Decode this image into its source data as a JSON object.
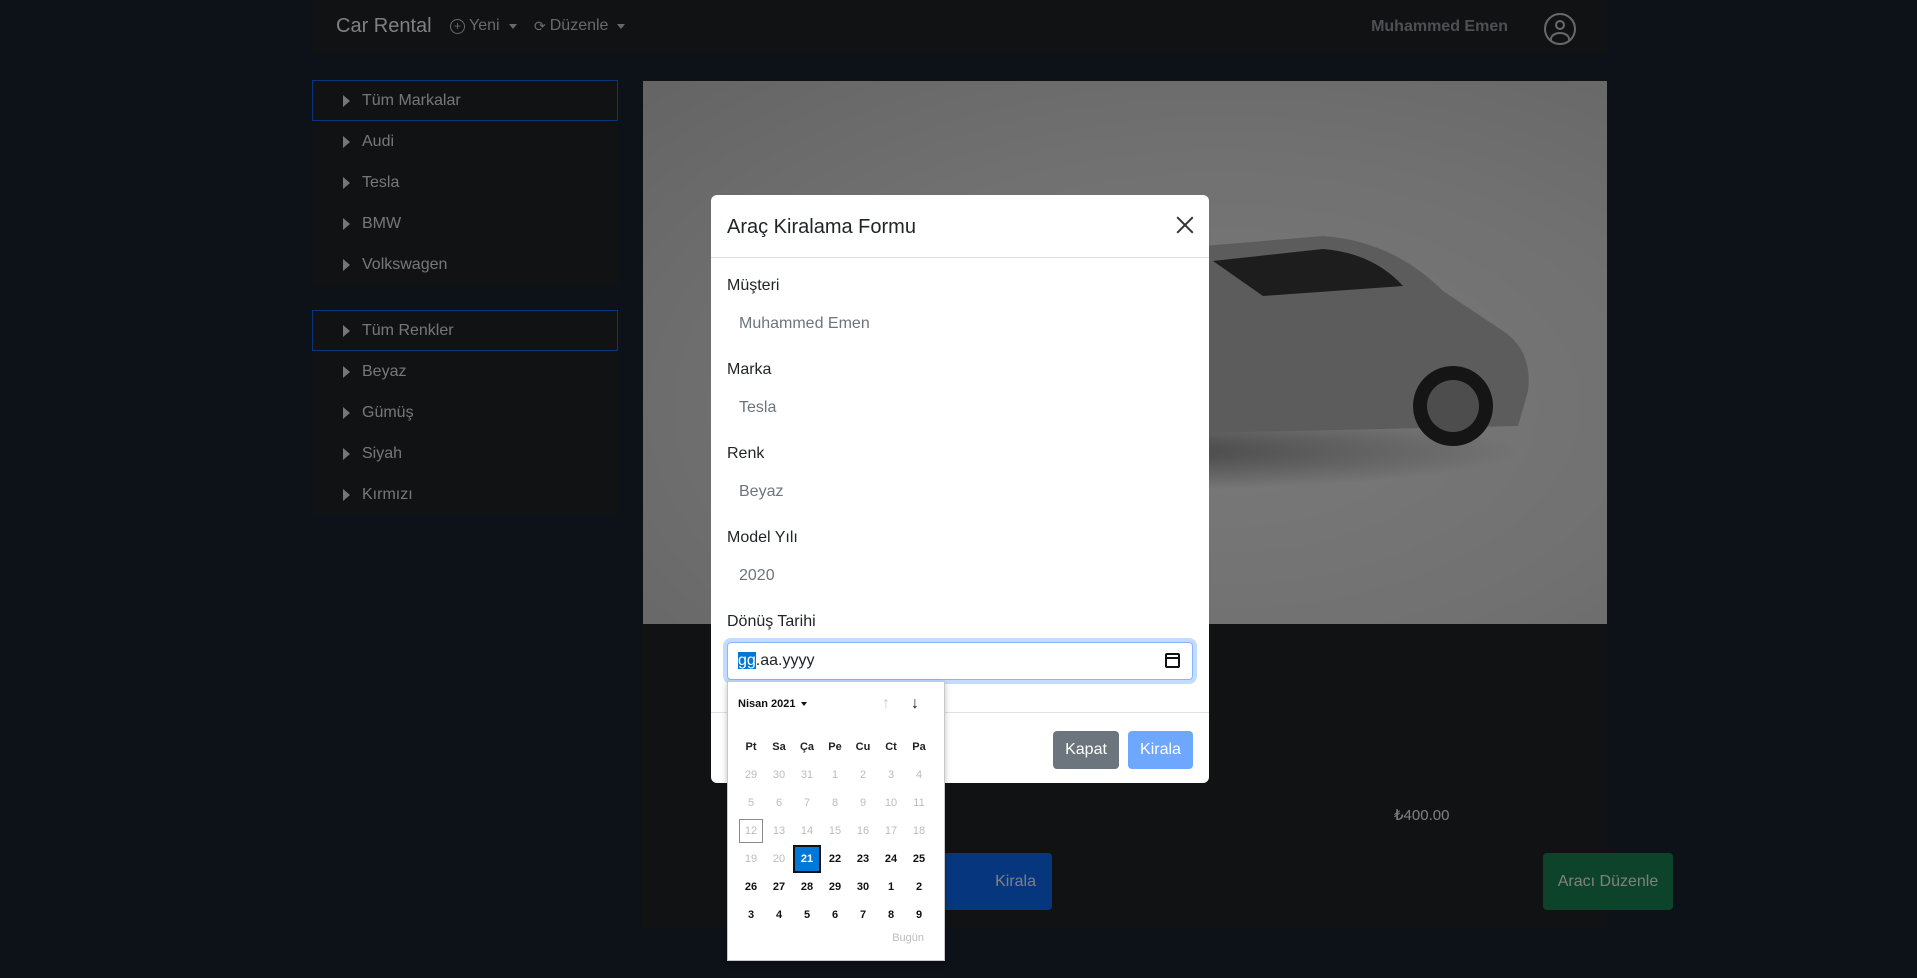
{
  "navbar": {
    "brand": "Car Rental",
    "menu_new": "Yeni",
    "menu_edit": "Düzenle",
    "user_name": "Muhammed Emen"
  },
  "brands": {
    "all": "Tüm Markalar",
    "items": [
      "Audi",
      "Tesla",
      "BMW",
      "Volkswagen"
    ]
  },
  "colors": {
    "all": "Tüm Renkler",
    "items": [
      "Beyaz",
      "Gümüş",
      "Siyah",
      "Kırmızı"
    ]
  },
  "card": {
    "price": "₺400.00",
    "rent_button": "Kirala",
    "edit_button": "Aracı Düzenle"
  },
  "modal": {
    "title": "Araç Kiralama Formu",
    "customer_label": "Müşteri",
    "customer_value": "Muhammed Emen",
    "brand_label": "Marka",
    "brand_value": "Tesla",
    "color_label": "Renk",
    "color_value": "Beyaz",
    "year_label": "Model Yılı",
    "year_value": "2020",
    "return_date_label": "Dönüş Tarihi",
    "date_placeholder_day": "gg",
    "date_placeholder_rest": ".aa.yyyy",
    "close_button": "Kapat",
    "rent_button": "Kirala"
  },
  "calendar": {
    "month": "Nisan 2021",
    "weekdays": [
      "Pt",
      "Sa",
      "Ça",
      "Pe",
      "Cu",
      "Ct",
      "Pa"
    ],
    "weeks": [
      [
        "29",
        "30",
        "31",
        "1",
        "2",
        "3",
        "4"
      ],
      [
        "5",
        "6",
        "7",
        "8",
        "9",
        "10",
        "11"
      ],
      [
        "12",
        "13",
        "14",
        "15",
        "16",
        "17",
        "18"
      ],
      [
        "19",
        "20",
        "21",
        "22",
        "23",
        "24",
        "25"
      ],
      [
        "26",
        "27",
        "28",
        "29",
        "30",
        "1",
        "2"
      ],
      [
        "3",
        "4",
        "5",
        "6",
        "7",
        "8",
        "9"
      ]
    ],
    "today": "12",
    "selected": "21",
    "today_link": "Bugün"
  },
  "theme": {
    "primary": "#0d6efd",
    "success": "#198754",
    "secondary": "#6c757d",
    "dark": "#212529"
  }
}
